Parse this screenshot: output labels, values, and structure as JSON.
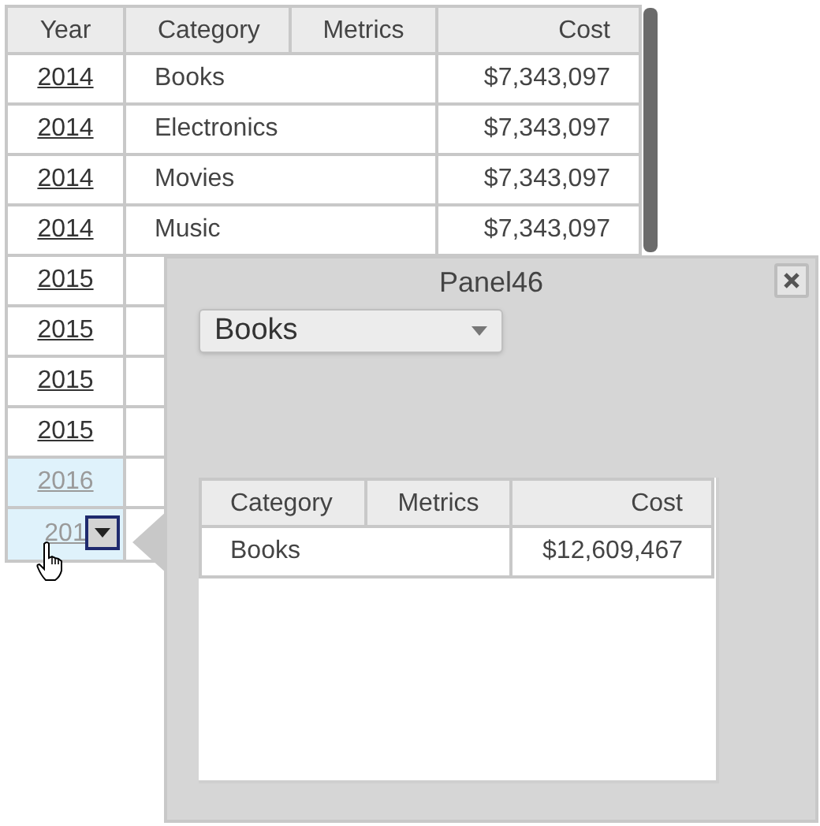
{
  "table": {
    "columns": [
      "Year",
      "Category",
      "Metrics",
      "Cost"
    ],
    "rows": [
      {
        "year": "2014",
        "category": "Books",
        "cost": "$7,343,097",
        "highlighted": false
      },
      {
        "year": "2014",
        "category": "Electronics",
        "cost": "$7,343,097",
        "highlighted": false
      },
      {
        "year": "2014",
        "category": "Movies",
        "cost": "$7,343,097",
        "highlighted": false
      },
      {
        "year": "2014",
        "category": "Music",
        "cost": "$7,343,097",
        "highlighted": false
      },
      {
        "year": "2015",
        "highlighted": false
      },
      {
        "year": "2015",
        "highlighted": false
      },
      {
        "year": "2015",
        "highlighted": false
      },
      {
        "year": "2015",
        "highlighted": false
      },
      {
        "year": "2016",
        "highlighted": true
      },
      {
        "year": "201",
        "highlighted": true,
        "dropdown_button": true
      }
    ]
  },
  "panel": {
    "title": "Panel46",
    "dropdown": {
      "value": "Books"
    },
    "table": {
      "columns": [
        "Category",
        "Metrics",
        "Cost"
      ],
      "rows": [
        {
          "category": "Books",
          "cost": "$12,609,467"
        }
      ]
    }
  }
}
